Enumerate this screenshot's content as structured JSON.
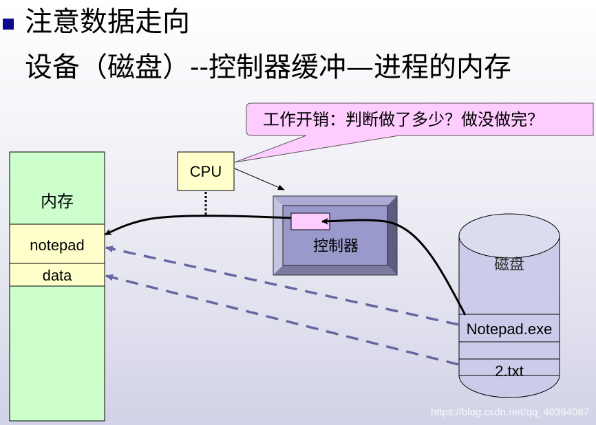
{
  "title": {
    "line1": "注意数据走向",
    "line2": "设备（磁盘）--控制器缓冲—进程的内存"
  },
  "callout": {
    "text": "工作开销：判断做了多少？做没做完？"
  },
  "memory": {
    "label": "内存",
    "slots": [
      "notepad",
      "data"
    ]
  },
  "cpu": {
    "label": "CPU"
  },
  "controller": {
    "label": "控制器"
  },
  "disk": {
    "label": "磁盘",
    "files": [
      "Notepad.exe",
      "2.txt"
    ]
  },
  "colors": {
    "memory_fill": "#ccffcc",
    "slot_fill": "#ffffcc",
    "cpu_fill": "#ffffcc",
    "callout_fill": "#ffccff",
    "controller_face": "#9999cc",
    "buffer_fill": "#ffccff",
    "disk_fill": "#ccccea",
    "dashed_arrow": "#6666a0",
    "bullet": "#0a0a8c"
  },
  "watermark": "https://blog.csdn.net/qq_40394087"
}
